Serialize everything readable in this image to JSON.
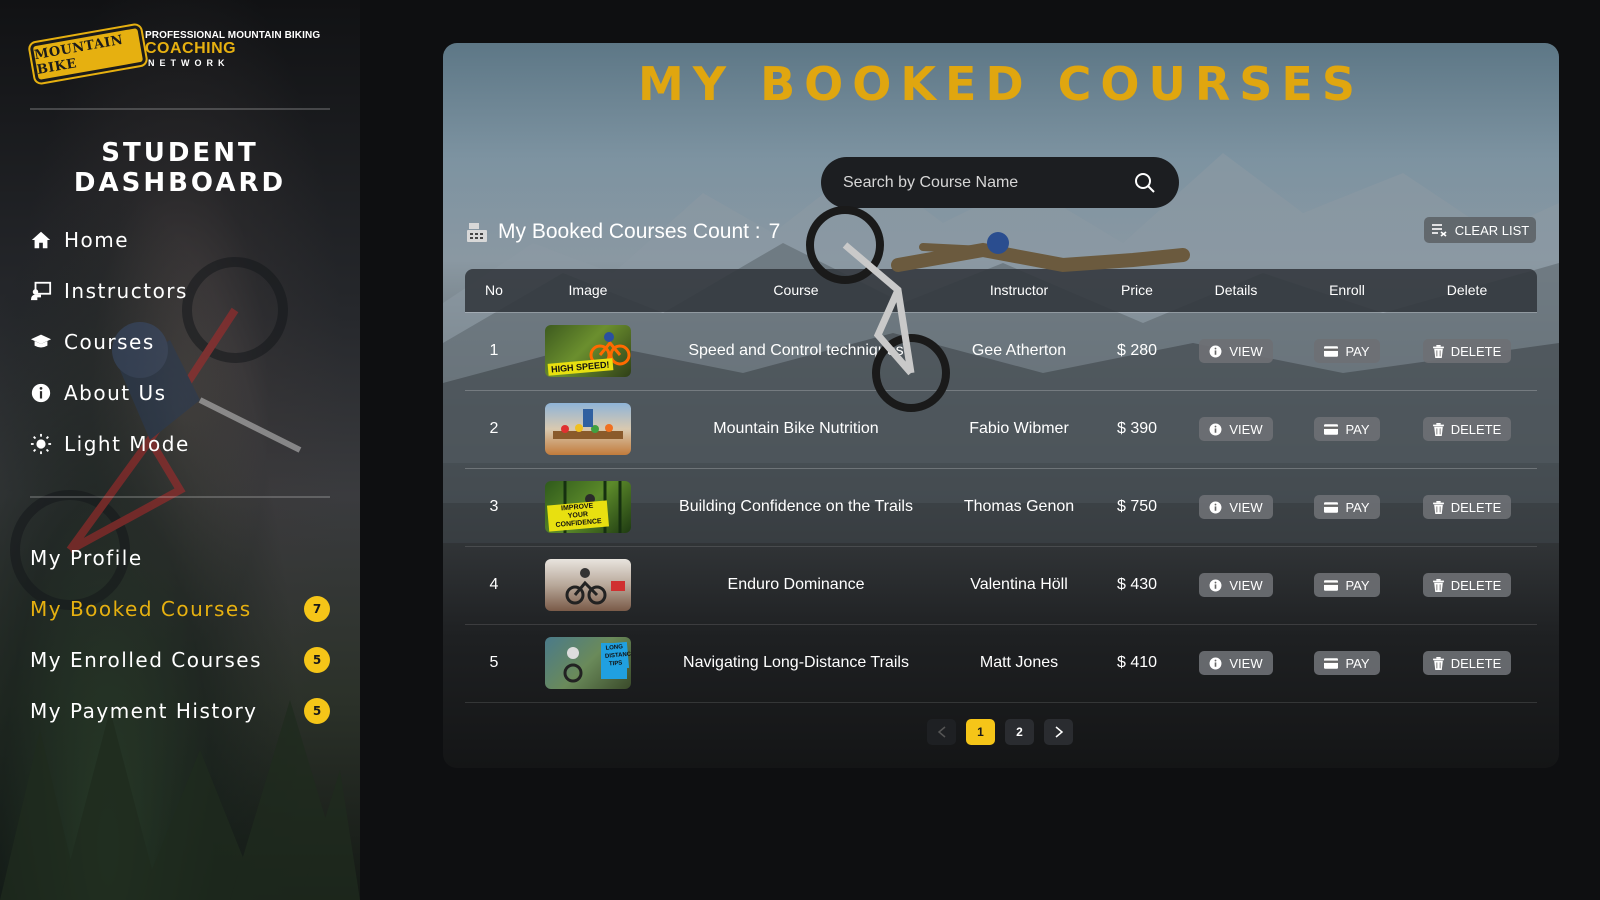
{
  "sidebar": {
    "logo": {
      "badge_text": "MOUNTAIN BIKE",
      "line1": "PROFESSIONAL MOUNTAIN BIKING",
      "line2": "COACHING",
      "line3": "NETWORK"
    },
    "dashboard_title": "STUDENT DASHBOARD",
    "main_nav": [
      {
        "label": "Home",
        "icon": "home-icon"
      },
      {
        "label": "Instructors",
        "icon": "instructor-icon"
      },
      {
        "label": "Courses",
        "icon": "graduation-cap-icon"
      },
      {
        "label": "About Us",
        "icon": "info-icon"
      },
      {
        "label": "Light Mode",
        "icon": "sun-icon"
      }
    ],
    "user_nav": [
      {
        "label": "My Profile",
        "badge": null,
        "active": false
      },
      {
        "label": "My Booked Courses",
        "badge": "7",
        "active": true
      },
      {
        "label": "My Enrolled Courses",
        "badge": "5",
        "active": false
      },
      {
        "label": "My Payment History",
        "badge": "5",
        "active": false
      }
    ]
  },
  "main": {
    "title": "MY BOOKED COURSES",
    "search": {
      "placeholder": "Search by Course Name",
      "value": ""
    },
    "count_label": "My Booked Courses Count :",
    "count_value": "7",
    "clear_label": "CLEAR LIST",
    "table": {
      "headers": [
        "No",
        "Image",
        "Course",
        "Instructor",
        "Price",
        "Details",
        "Enroll",
        "Delete"
      ],
      "rows": [
        {
          "no": "1",
          "course": "Speed and Control techniques",
          "instructor": "Gee Atherton",
          "price": "$ 280",
          "thumb_tag": "HIGH SPEED!"
        },
        {
          "no": "2",
          "course": "Mountain Bike Nutrition",
          "instructor": "Fabio Wibmer",
          "price": "$ 390",
          "thumb_tag": ""
        },
        {
          "no": "3",
          "course": "Building Confidence on the Trails",
          "instructor": "Thomas Genon",
          "price": "$ 750",
          "thumb_tag": "IMPROVE YOUR CONFIDENCE"
        },
        {
          "no": "4",
          "course": "Enduro Dominance",
          "instructor": "Valentina Höll",
          "price": "$ 430",
          "thumb_tag": ""
        },
        {
          "no": "5",
          "course": "Navigating Long-Distance Trails",
          "instructor": "Matt Jones",
          "price": "$ 410",
          "thumb_tag": "LONG DISTANCE TIPS"
        }
      ],
      "view_label": "VIEW",
      "pay_label": "PAY",
      "delete_label": "DELETE"
    },
    "pagination": {
      "pages": [
        "1",
        "2"
      ],
      "current": "1"
    }
  },
  "colors": {
    "accent": "#e0a60f",
    "badge": "#f5c518",
    "background": "#0e0f11"
  }
}
